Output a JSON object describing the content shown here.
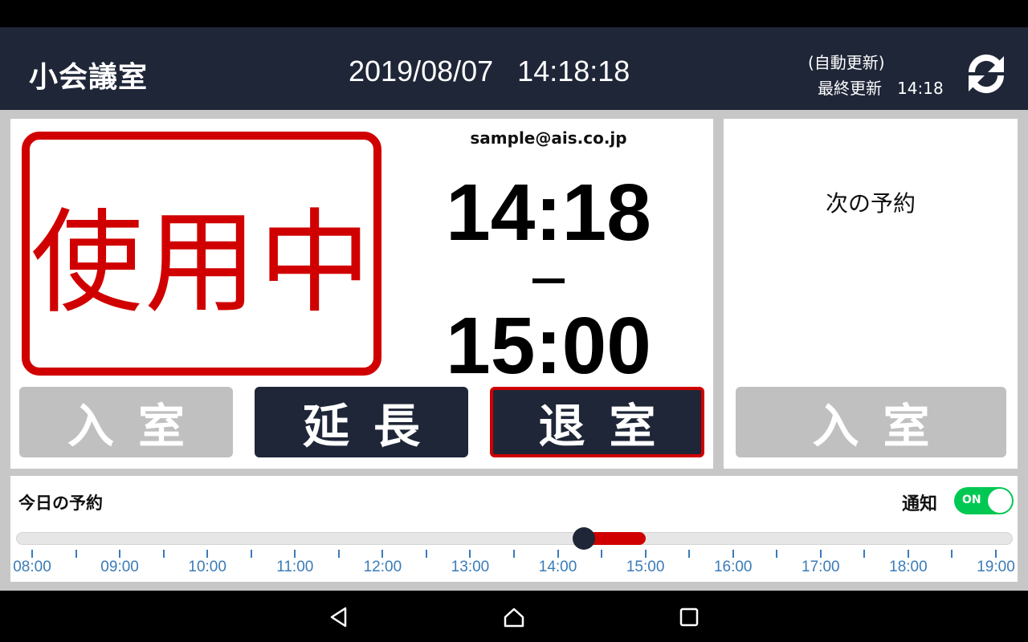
{
  "header": {
    "room_name": "小会議室",
    "datetime": "2019/08/07   14:18:18",
    "auto_update": "(自動更新)",
    "last_update": "最終更新   14:18"
  },
  "current": {
    "status": "使用中",
    "organizer": "sample@ais.co.jp",
    "start_time": "14:18",
    "end_time": "15:00",
    "buttons": {
      "enter": "入室",
      "extend": "延長",
      "exit": "退室"
    }
  },
  "next": {
    "title": "次の予約",
    "enter_button": "入室"
  },
  "timeline": {
    "title": "今日の予約",
    "notify_label": "通知",
    "notify_state": "ON",
    "hours": [
      "08:00",
      "09:00",
      "10:00",
      "11:00",
      "12:00",
      "13:00",
      "14:00",
      "15:00",
      "16:00",
      "17:00",
      "18:00",
      "19:00"
    ],
    "reservation": {
      "start": "14:18",
      "end": "15:00"
    },
    "current_time": "14:18"
  },
  "colors": {
    "header_bg": "#1f2638",
    "accent_red": "#d00000",
    "disabled_gray": "#c0c0c0",
    "toggle_on": "#00c853",
    "tick_blue": "#3a7bb8"
  },
  "icons": {
    "refresh": "refresh-icon",
    "nav_back": "back-triangle-icon",
    "nav_home": "home-icon",
    "nav_recents": "recents-square-icon"
  }
}
